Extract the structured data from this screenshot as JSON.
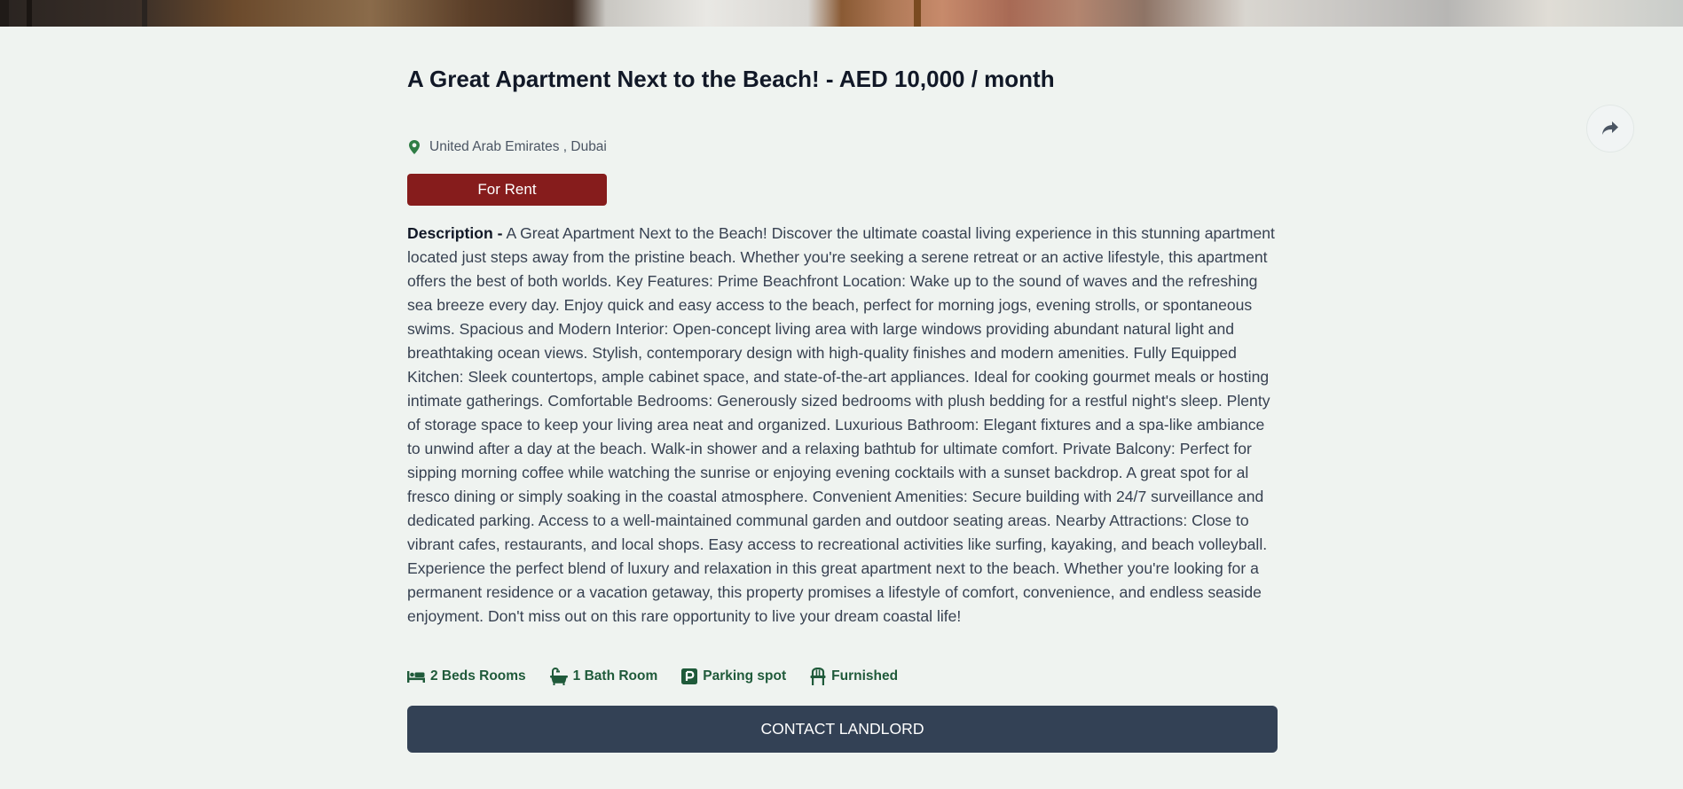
{
  "listing": {
    "title": "A Great Apartment Next to the Beach! - AED 10,000 / month",
    "location": "United Arab Emirates , Dubai",
    "status_badge": "For Rent",
    "description_label": "Description -",
    "description_text": " A Great Apartment Next to the Beach! Discover the ultimate coastal living experience in this stunning apartment located just steps away from the pristine beach. Whether you're seeking a serene retreat or an active lifestyle, this apartment offers the best of both worlds. Key Features: Prime Beachfront Location: Wake up to the sound of waves and the refreshing sea breeze every day. Enjoy quick and easy access to the beach, perfect for morning jogs, evening strolls, or spontaneous swims. Spacious and Modern Interior: Open-concept living area with large windows providing abundant natural light and breathtaking ocean views. Stylish, contemporary design with high-quality finishes and modern amenities. Fully Equipped Kitchen: Sleek countertops, ample cabinet space, and state-of-the-art appliances. Ideal for cooking gourmet meals or hosting intimate gatherings. Comfortable Bedrooms: Generously sized bedrooms with plush bedding for a restful night's sleep. Plenty of storage space to keep your living area neat and organized. Luxurious Bathroom: Elegant fixtures and a spa-like ambiance to unwind after a day at the beach. Walk-in shower and a relaxing bathtub for ultimate comfort. Private Balcony: Perfect for sipping morning coffee while watching the sunrise or enjoying evening cocktails with a sunset backdrop. A great spot for al fresco dining or simply soaking in the coastal atmosphere. Convenient Amenities: Secure building with 24/7 surveillance and dedicated parking. Access to a well-maintained communal garden and outdoor seating areas. Nearby Attractions: Close to vibrant cafes, restaurants, and local shops. Easy access to recreational activities like surfing, kayaking, and beach volleyball. Experience the perfect blend of luxury and relaxation in this great apartment next to the beach. Whether you're looking for a permanent residence or a vacation getaway, this property promises a lifestyle of comfort, convenience, and endless seaside enjoyment. Don't miss out on this rare opportunity to live your dream coastal life!",
    "features": [
      {
        "label": "2 Beds Rooms",
        "icon": "bed-icon"
      },
      {
        "label": "1 Bath Room",
        "icon": "bathtub-icon"
      },
      {
        "label": "Parking spot",
        "icon": "parking-icon"
      },
      {
        "label": "Furnished",
        "icon": "chair-icon"
      }
    ],
    "contact_button_label": "CONTACT LANDLORD"
  },
  "icons": {
    "location": "map-pin-icon",
    "share": "share-icon"
  },
  "colors": {
    "page_background": "#eff3f0",
    "badge_background": "#861c1c",
    "feature_text": "#1f5a3a",
    "pin": "#2f7d45",
    "button_background": "#334155"
  }
}
